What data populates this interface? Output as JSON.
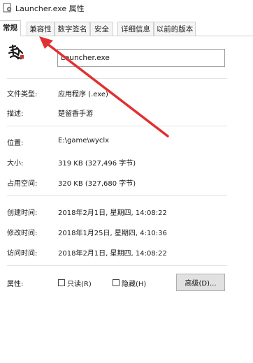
{
  "window": {
    "title": "Launcher.exe 属性",
    "icon": "gear-document-icon"
  },
  "tabs": [
    {
      "label": "常规",
      "active": true
    },
    {
      "label": "兼容性",
      "active": false
    },
    {
      "label": "数字签名",
      "active": false
    },
    {
      "label": "安全",
      "active": false
    },
    {
      "label": "详细信息",
      "active": false
    },
    {
      "label": "以前的版本",
      "active": false
    }
  ],
  "general": {
    "file_icon": "calligraphy-app-icon",
    "file_name": "Launcher.exe",
    "type_label": "文件类型:",
    "type_value": "应用程序 (.exe)",
    "desc_label": "描述:",
    "desc_value": "楚留香手游",
    "location_label": "位置:",
    "location_value": "E:\\game\\wyclx",
    "size_label": "大小:",
    "size_value": "319 KB (327,496 字节)",
    "disk_label": "占用空间:",
    "disk_value": "320 KB (327,680 字节)",
    "created_label": "创建时间:",
    "created_value": "2018年2月1日, 星期四, 14:08:22",
    "modified_label": "修改时间:",
    "modified_value": "2018年1月25日, 星期四, 4:10:36",
    "accessed_label": "访问时间:",
    "accessed_value": "2018年2月1日, 星期四, 14:08:22",
    "attributes_label": "属性:",
    "readonly_label": "只读(R)",
    "readonly_checked": false,
    "hidden_label": "隐藏(H)",
    "hidden_checked": false,
    "advanced_button": "高级(D)..."
  },
  "annotation": {
    "arrow_color": "#e03030",
    "arrow_target": "兼容性"
  }
}
